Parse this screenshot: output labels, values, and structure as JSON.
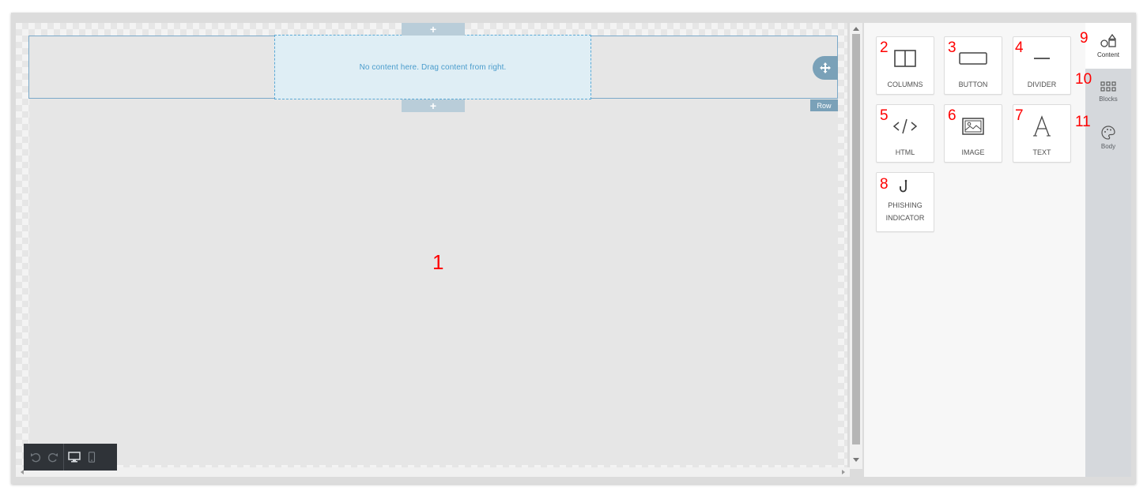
{
  "canvas": {
    "empty_message": "No content here. Drag content from right.",
    "add_row_symbol": "+",
    "row_label": "Row"
  },
  "callouts": {
    "canvas": "1",
    "columns": "2",
    "button": "3",
    "divider": "4",
    "html": "5",
    "image": "6",
    "text": "7",
    "phishing": "8",
    "content_tab": "9",
    "blocks_tab": "10",
    "body_tab": "11"
  },
  "content_tiles": [
    {
      "label": "COLUMNS",
      "icon": "columns-icon"
    },
    {
      "label": "BUTTON",
      "icon": "button-icon"
    },
    {
      "label": "DIVIDER",
      "icon": "divider-icon"
    },
    {
      "label": "HTML",
      "icon": "html-icon"
    },
    {
      "label": "IMAGE",
      "icon": "image-icon"
    },
    {
      "label": "TEXT",
      "icon": "text-icon"
    },
    {
      "label": "PHISHING\nINDICATOR",
      "label_line1": "PHISHING",
      "label_line2": "INDICATOR",
      "icon": "hook-icon"
    }
  ],
  "side_tabs": [
    {
      "label": "Content",
      "icon": "shapes-icon",
      "active": true
    },
    {
      "label": "Blocks",
      "icon": "grid-icon",
      "active": false
    },
    {
      "label": "Body",
      "icon": "palette-icon",
      "active": false
    }
  ],
  "toolbar": {
    "undo_icon": "undo-icon",
    "redo_icon": "redo-icon",
    "desktop_icon": "desktop-icon",
    "mobile_icon": "mobile-icon"
  },
  "colors": {
    "callout": "#ff0000",
    "accent": "#7aa1b8",
    "drop_zone": "#dfeef5"
  }
}
